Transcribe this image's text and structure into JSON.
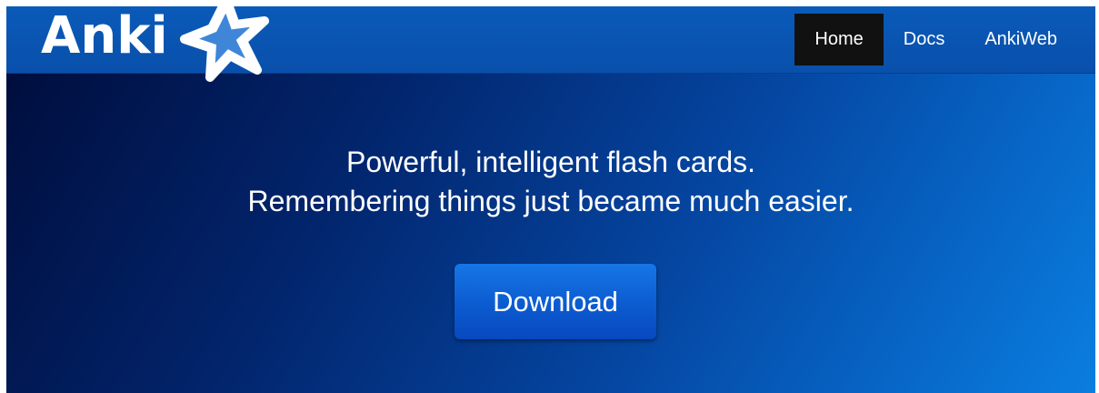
{
  "navbar": {
    "brand": {
      "text": "Anki",
      "icon": "star-logo-icon"
    },
    "items": [
      {
        "label": "Home",
        "active": true
      },
      {
        "label": "Docs",
        "active": false
      },
      {
        "label": "AnkiWeb",
        "active": false
      }
    ]
  },
  "hero": {
    "line1": "Powerful, intelligent flash cards.",
    "line2": "Remembering things just became much easier.",
    "download_label": "Download"
  },
  "colors": {
    "navbar": "#0a5ab9",
    "active_nav": "#111111",
    "button": "#0c5bd0",
    "hero_dark": "#000e3e",
    "hero_light": "#0a7ee0"
  }
}
